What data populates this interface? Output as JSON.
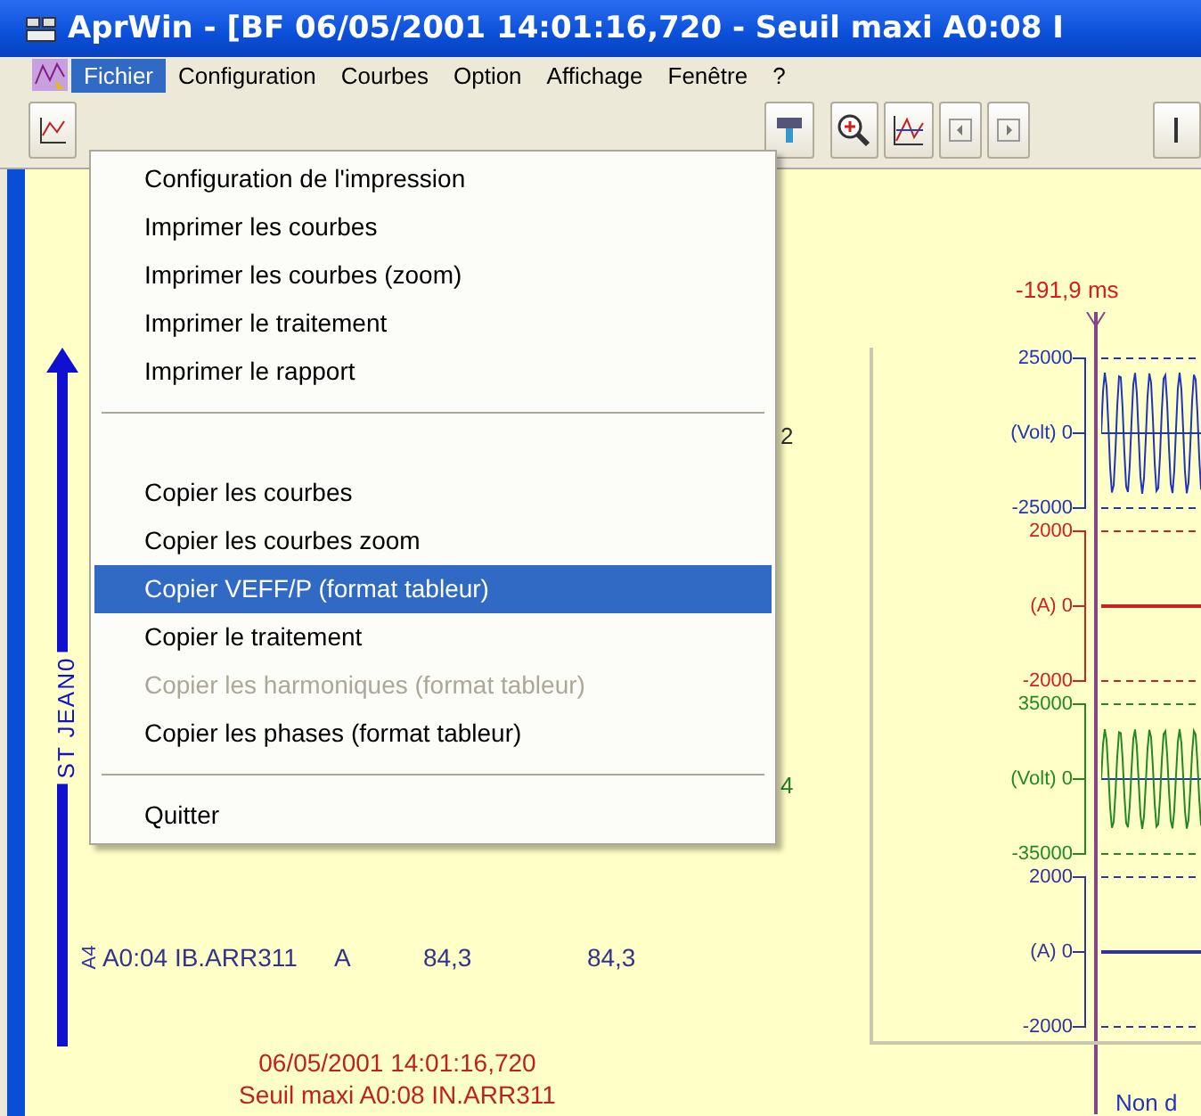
{
  "window": {
    "title": "AprWin  - [BF 06/05/2001 14:01:16,720 - Seuil maxi A0:08 I"
  },
  "menu_bar": [
    {
      "label": "Fichier",
      "selected": true
    },
    {
      "label": "Configuration",
      "selected": false
    },
    {
      "label": "Courbes",
      "selected": false
    },
    {
      "label": "Option",
      "selected": false
    },
    {
      "label": "Affichage",
      "selected": false
    },
    {
      "label": "Fenêtre",
      "selected": false
    },
    {
      "label": "?",
      "selected": false
    }
  ],
  "file_menu": [
    {
      "kind": "item",
      "label": "Configuration de l'impression",
      "selected": false,
      "disabled": false
    },
    {
      "kind": "item",
      "label": "Imprimer les courbes",
      "selected": false,
      "disabled": false
    },
    {
      "kind": "item",
      "label": "Imprimer les courbes (zoom)",
      "selected": false,
      "disabled": false
    },
    {
      "kind": "item",
      "label": "Imprimer le traitement",
      "selected": false,
      "disabled": false
    },
    {
      "kind": "item",
      "label": "Imprimer le rapport",
      "selected": false,
      "disabled": false
    },
    {
      "kind": "separator"
    },
    {
      "kind": "blank"
    },
    {
      "kind": "item",
      "label": "Copier les courbes",
      "selected": false,
      "disabled": false
    },
    {
      "kind": "item",
      "label": "Copier les courbes zoom",
      "selected": false,
      "disabled": false
    },
    {
      "kind": "item",
      "label": "Copier VEFF/P (format tableur)",
      "selected": true,
      "disabled": false
    },
    {
      "kind": "item",
      "label": "Copier le traitement",
      "selected": false,
      "disabled": false
    },
    {
      "kind": "item",
      "label": "Copier les harmoniques (format tableur)",
      "selected": false,
      "disabled": true
    },
    {
      "kind": "item",
      "label": "Copier les phases (format tableur)",
      "selected": false,
      "disabled": false
    },
    {
      "kind": "separator"
    },
    {
      "kind": "item",
      "label": "Quitter",
      "selected": false,
      "disabled": false
    }
  ],
  "document": {
    "time_marker": "-191,9 ms",
    "station_label": "ST JEAN0",
    "fragments": [
      "2",
      "4"
    ],
    "channel_row": {
      "tag": "A4",
      "cells": [
        "A0:04 IB.ARR311",
        "A",
        "84,3",
        "84,3"
      ]
    },
    "footer": [
      "06/05/2001 14:01:16,720",
      "Seuil maxi A0:08 IN.ARR311"
    ],
    "tracks": [
      {
        "kind": "wave",
        "color": "#2233bb",
        "ticks": [
          "25000",
          "(Volt) 0",
          "-25000"
        ]
      },
      {
        "kind": "flat",
        "color": "#cc2222",
        "ticks": [
          "2000",
          "(A) 0",
          "-2000"
        ]
      },
      {
        "kind": "wave",
        "color": "#228822",
        "ticks": [
          "35000",
          "(Volt) 0",
          "-35000"
        ]
      },
      {
        "kind": "flat",
        "color": "#333399",
        "ticks": [
          "2000",
          "(A) 0",
          "-2000"
        ]
      }
    ],
    "cursor_label": "Non d"
  }
}
